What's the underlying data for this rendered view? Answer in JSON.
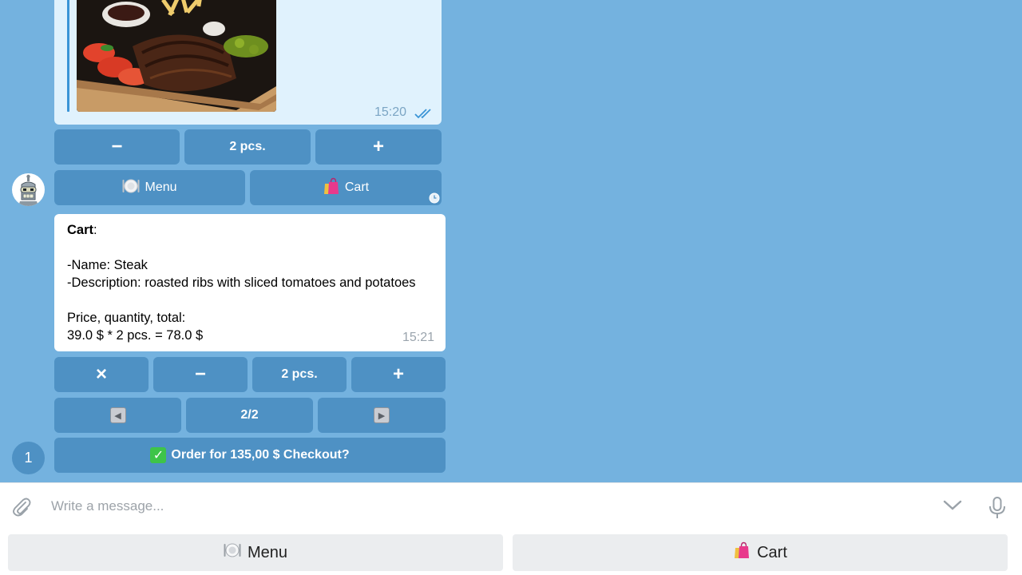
{
  "photo_message": {
    "time": "15:20"
  },
  "quantity_row": {
    "minus": "−",
    "qty": "2 pcs.",
    "plus": "+"
  },
  "nav_row": {
    "menu_label": "Menu",
    "cart_label": "Cart"
  },
  "cart_message": {
    "heading": "Cart",
    "heading_colon": ":",
    "name_line": "-Name: Steak",
    "description_line": "-Description: roasted ribs with sliced tomatoes and potatoes",
    "price_heading": "Price, quantity, total:",
    "price_line": "39.0 $ * 2 pcs. = 78.0 $",
    "time": "15:21"
  },
  "cart_controls": {
    "remove": "×",
    "minus": "−",
    "qty": "2 pcs.",
    "plus": "+"
  },
  "pagination": {
    "prev_glyph": "◀",
    "page": "2/2",
    "next_glyph": "▶"
  },
  "checkout": {
    "check_glyph": "✓",
    "label": "Order for 135,00 $ Checkout?"
  },
  "unread_count": "1",
  "composer": {
    "placeholder": "Write a message..."
  },
  "reply_keyboard": {
    "menu_label": "Menu",
    "cart_label": "Cart"
  },
  "colors": {
    "chat_background": "#74b2df",
    "inline_button": "#4e91c4",
    "outgoing_bubble": "#e0f2fd",
    "incoming_bubble": "#ffffff",
    "reply_button": "#ebedef"
  },
  "icons": [
    "plate-icon",
    "shopping-bags-icon",
    "check-mark-icon",
    "attach-icon",
    "chevron-down-icon",
    "microphone-icon",
    "clock-icon",
    "double-check-icon",
    "bot-avatar"
  ]
}
